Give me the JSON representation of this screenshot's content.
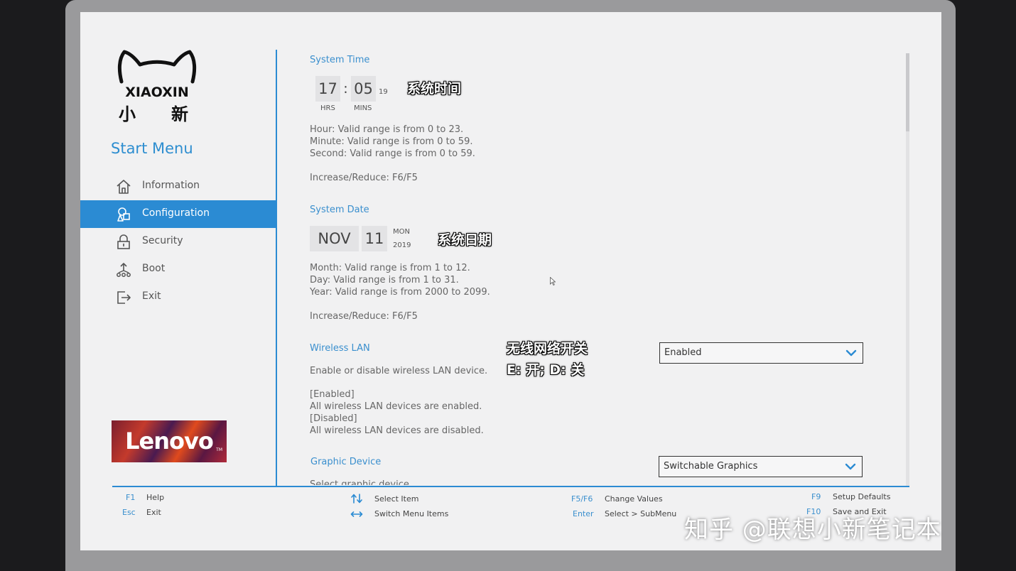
{
  "brand": {
    "logo_word": "XIAOXIN",
    "logo_cn_1": "小",
    "logo_cn_2": "新",
    "lenovo": "Lenovo",
    "tm": "TM"
  },
  "sidebar": {
    "title": "Start Menu",
    "items": [
      {
        "label": "Information",
        "icon": "home-icon"
      },
      {
        "label": "Configuration",
        "icon": "configuration-icon",
        "active": true
      },
      {
        "label": "Security",
        "icon": "lock-icon"
      },
      {
        "label": "Boot",
        "icon": "boot-icon"
      },
      {
        "label": "Exit",
        "icon": "exit-icon"
      }
    ]
  },
  "system_time": {
    "title": "System Time",
    "hours": "17",
    "separator": ":",
    "minutes": "05",
    "seconds": "19",
    "hrs_label": "HRS",
    "mins_label": "MINS",
    "help_1": "Hour: Valid range is from 0 to 23.",
    "help_2": "Minute: Valid range is from 0 to 59.",
    "help_3": "Second: Valid range is from 0 to 59.",
    "keys": "Increase/Reduce: F6/F5",
    "annotation": "系统时间"
  },
  "system_date": {
    "title": "System Date",
    "month": "NOV",
    "day": "11",
    "weekday": "MON",
    "year": "2019",
    "help_1": "Month: Valid range is from 1 to 12.",
    "help_2": "Day: Valid range is from 1 to 31.",
    "help_3": "Year: Valid range is from 2000 to 2099.",
    "keys": "Increase/Reduce: F6/F5",
    "annotation": "系统日期"
  },
  "wireless_lan": {
    "title": "Wireless LAN",
    "value": "Enabled",
    "desc": "Enable or disable wireless LAN device.",
    "opt1": "[Enabled]",
    "opt1_desc": "All wireless LAN devices are enabled.",
    "opt2": "[Disabled]",
    "opt2_desc": "All wireless LAN devices are disabled.",
    "annotation_1": "无线网络开关",
    "annotation_2": "E: 开; D: 关"
  },
  "graphic_device": {
    "title": "Graphic Device",
    "value": "Switchable Graphics",
    "desc": "Select graphic device"
  },
  "footer": {
    "f1_key": "F1",
    "f1_desc": "Help",
    "esc_key": "Esc",
    "esc_desc": "Exit",
    "updown_desc": "Select Item",
    "leftright_desc": "Switch Menu Items",
    "f5f6_key": "F5/F6",
    "f5f6_desc": "Change Values",
    "enter_key": "Enter",
    "enter_desc": "Select > SubMenu",
    "f9_key": "F9",
    "f9_desc": "Setup Defaults",
    "f10_key": "F10",
    "f10_desc": "Save and Exit"
  },
  "watermark": "知乎 @联想小新笔记本",
  "colors": {
    "accent": "#2b8bd3",
    "title_blue": "#3a8fce",
    "screen_bg": "#f1f1f2"
  }
}
